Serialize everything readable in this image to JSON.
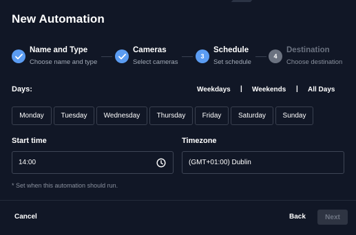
{
  "dialog": {
    "title": "New Automation"
  },
  "steps": [
    {
      "number": "1",
      "title": "Name and Type",
      "subtitle": "Choose name and type",
      "status": "done"
    },
    {
      "number": "2",
      "title": "Cameras",
      "subtitle": "Select cameras",
      "status": "done"
    },
    {
      "number": "3",
      "title": "Schedule",
      "subtitle": "Set schedule",
      "status": "active"
    },
    {
      "number": "4",
      "title": "Destination",
      "subtitle": "Choose destination",
      "status": "pending"
    }
  ],
  "days": {
    "label": "Days:",
    "quick_select": [
      "Weekdays",
      "Weekends",
      "All Days"
    ],
    "separator": "|",
    "items": [
      "Monday",
      "Tuesday",
      "Wednesday",
      "Thursday",
      "Friday",
      "Saturday",
      "Sunday"
    ]
  },
  "start_time": {
    "label": "Start time",
    "value": "14:00"
  },
  "timezone": {
    "label": "Timezone",
    "value": "(GMT+01:00) Dublin"
  },
  "hint": "* Set when this automation should run.",
  "footer": {
    "cancel": "Cancel",
    "back": "Back",
    "next": "Next"
  },
  "colors": {
    "accent": "#5b9cf2",
    "pending": "#6b7280",
    "background": "#111726"
  },
  "icons": {
    "done": "check-icon",
    "time": "clock-icon"
  }
}
